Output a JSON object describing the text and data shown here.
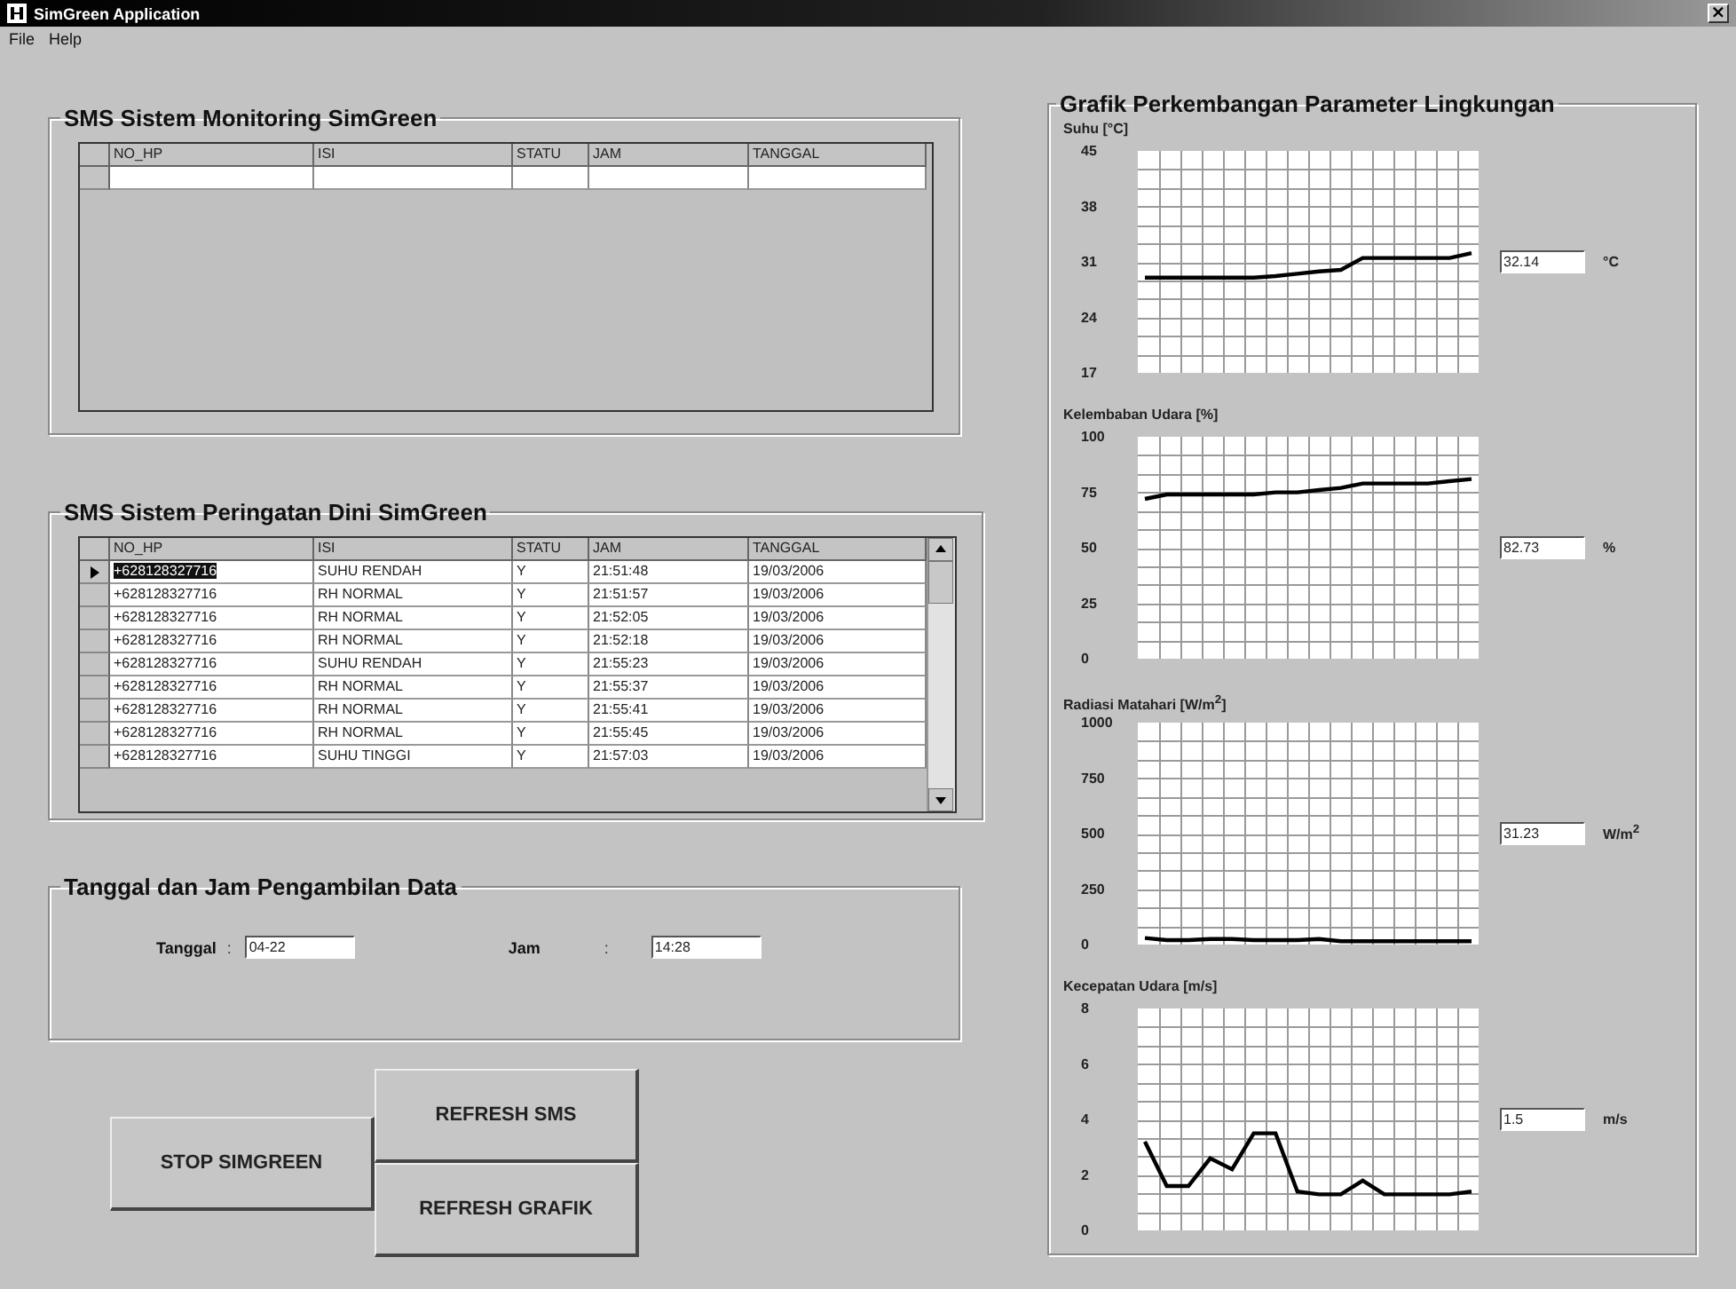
{
  "window": {
    "title": "SimGreen Application",
    "close": "×"
  },
  "menu": [
    {
      "label": "File"
    },
    {
      "label": "Help"
    }
  ],
  "monitoring": {
    "title": "SMS Sistem Monitoring SimGreen",
    "columns": [
      "NO_HP",
      "ISI",
      "STATU",
      "JAM",
      "TANGGAL"
    ],
    "new_row": true,
    "scrollbar": false
  },
  "warning": {
    "title": "SMS Sistem Peringatan Dini SimGreen",
    "columns": [
      "NO_HP",
      "ISI",
      "STATU",
      "JAM",
      "TANGGAL"
    ],
    "new_row": false,
    "scrollbar": true,
    "rows": [
      {
        "cells": [
          "+628128327716",
          "SUHU RENDAH",
          "Y",
          "21:51:48",
          "19/03/2006"
        ],
        "selected": true
      },
      {
        "cells": [
          "+628128327716",
          "RH NORMAL",
          "Y",
          "21:51:57",
          "19/03/2006"
        ],
        "selected": false
      },
      {
        "cells": [
          "+628128327716",
          "RH NORMAL",
          "Y",
          "21:52:05",
          "19/03/2006"
        ],
        "selected": false
      },
      {
        "cells": [
          "+628128327716",
          "RH NORMAL",
          "Y",
          "21:52:18",
          "19/03/2006"
        ],
        "selected": false
      },
      {
        "cells": [
          "+628128327716",
          "SUHU RENDAH",
          "Y",
          "21:55:23",
          "19/03/2006"
        ],
        "selected": false
      },
      {
        "cells": [
          "+628128327716",
          "RH NORMAL",
          "Y",
          "21:55:37",
          "19/03/2006"
        ],
        "selected": false
      },
      {
        "cells": [
          "+628128327716",
          "RH NORMAL",
          "Y",
          "21:55:41",
          "19/03/2006"
        ],
        "selected": false
      },
      {
        "cells": [
          "+628128327716",
          "RH NORMAL",
          "Y",
          "21:55:45",
          "19/03/2006"
        ],
        "selected": false
      },
      {
        "cells": [
          "+628128327716",
          "SUHU TINGGI",
          "Y",
          "21:57:03",
          "19/03/2006"
        ],
        "selected": false
      }
    ]
  },
  "retrieval": {
    "title": "Tanggal dan Jam Pengambilan Data",
    "fields": [
      {
        "label": "Tanggal",
        "separator": ":",
        "value": "04-22"
      },
      {
        "label": "Jam",
        "separator": ":",
        "value": "14:28"
      }
    ]
  },
  "buttons": [
    {
      "label": "STOP SIMGREEN"
    },
    {
      "label": "REFRESH SMS"
    },
    {
      "label": "REFRESH GRAFIK"
    }
  ],
  "graphs": {
    "title": "Grafik Perkembangan Parameter Lingkungan",
    "charts": [
      {
        "label": "Suhu [°C]",
        "value": "32.14",
        "unit": "°C",
        "chart_data": {
          "type": "line",
          "grid": true,
          "ylim": [
            17,
            45
          ],
          "yticks": [
            17,
            24,
            31,
            38,
            45
          ],
          "series": [
            {
              "color": "#000000",
              "values": [
                29,
                29,
                29,
                29,
                29,
                29,
                29.2,
                29.5,
                29.8,
                30,
                31.5,
                31.5,
                31.5,
                31.5,
                31.5,
                32.1
              ]
            }
          ]
        }
      },
      {
        "label": "Kelembaban Udara [%]",
        "value": "82.73",
        "unit": "%",
        "chart_data": {
          "type": "line",
          "grid": true,
          "ylim": [
            0,
            100
          ],
          "yticks": [
            0,
            25,
            50,
            75,
            100
          ],
          "series": [
            {
              "color": "#000000",
              "values": [
                72,
                74,
                74,
                74,
                74,
                74,
                75,
                75,
                76,
                77,
                79,
                79,
                79,
                79,
                80,
                81
              ]
            }
          ]
        }
      },
      {
        "label": "Radiasi Matahari [W/m$^{2}$]",
        "value": "31.23",
        "unit": "W/m$^{2}$",
        "chart_data": {
          "type": "line",
          "grid": true,
          "ylim": [
            0,
            1000
          ],
          "yticks": [
            0,
            250,
            500,
            750,
            1000
          ],
          "series": [
            {
              "color": "#000000",
              "values": [
                30,
                20,
                20,
                25,
                25,
                20,
                20,
                20,
                25,
                15,
                15,
                15,
                15,
                15,
                15,
                15
              ]
            }
          ]
        }
      },
      {
        "label": "Kecepatan Udara [m/s]",
        "value": "1.5",
        "unit": "m/s",
        "chart_data": {
          "type": "line",
          "grid": true,
          "ylim": [
            0,
            8
          ],
          "yticks": [
            0,
            2,
            4,
            6,
            8
          ],
          "series": [
            {
              "color": "#000000",
              "values": [
                3.2,
                1.6,
                1.6,
                2.6,
                2.2,
                3.5,
                3.5,
                1.4,
                1.3,
                1.3,
                1.8,
                1.3,
                1.3,
                1.3,
                1.3,
                1.4
              ]
            }
          ]
        }
      }
    ]
  }
}
